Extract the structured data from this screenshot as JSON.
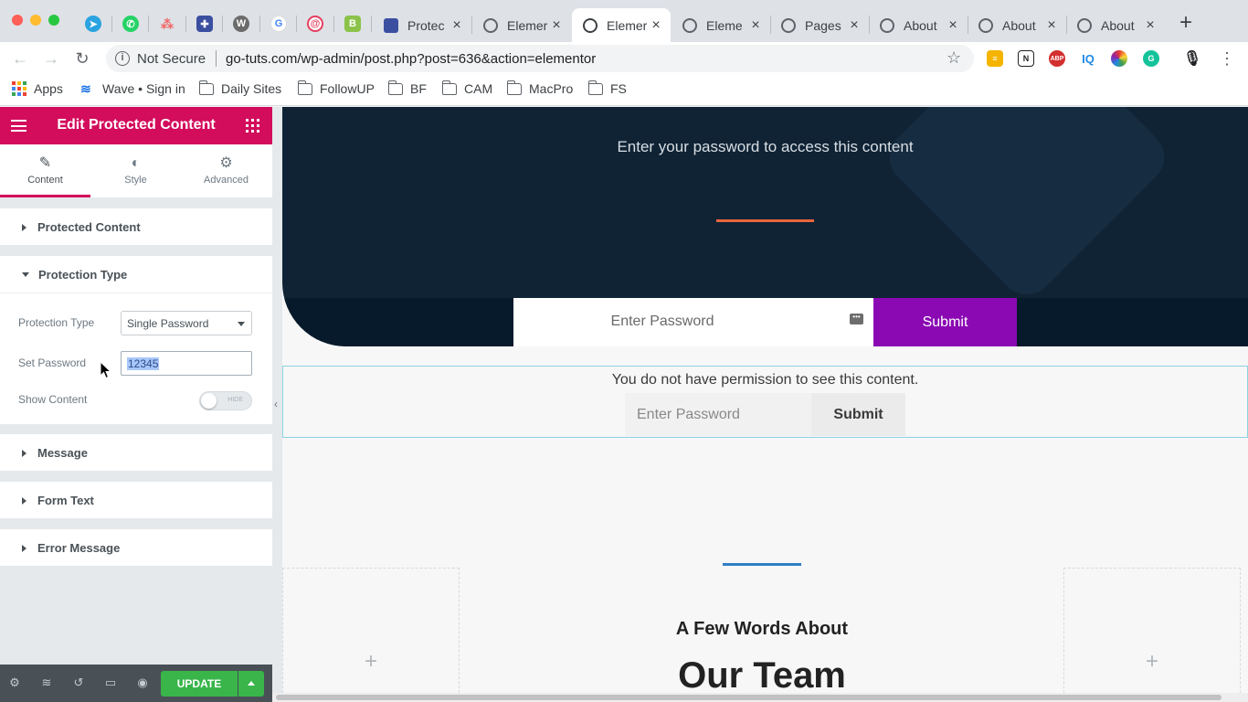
{
  "tabs": [
    {
      "title": "Protec",
      "icon": "wpforms-icon",
      "color": "#3b4fa0",
      "active": false
    },
    {
      "title": "Elemer",
      "icon": "globe-icon",
      "color": "#5f6368",
      "active": false
    },
    {
      "title": "Elemer",
      "icon": "globe-icon",
      "color": "#5f6368",
      "active": true
    },
    {
      "title": "Eleme",
      "icon": "globe-icon",
      "color": "#5f6368",
      "active": false
    },
    {
      "title": "Pages",
      "icon": "globe-icon",
      "color": "#5f6368",
      "active": false
    },
    {
      "title": "About",
      "icon": "globe-icon",
      "color": "#5f6368",
      "active": false
    },
    {
      "title": "About",
      "icon": "globe-icon",
      "color": "#5f6368",
      "active": false
    },
    {
      "title": "About",
      "icon": "globe-icon",
      "color": "#5f6368",
      "active": false
    }
  ],
  "address": {
    "security_label": "Not Secure",
    "url": "go-tuts.com/wp-admin/post.php?post=636&action=elementor"
  },
  "extensions": [
    {
      "name": "extension-yellow-icon",
      "label": "",
      "color": "#f4b400"
    },
    {
      "name": "extension-notion-icon",
      "label": "N",
      "color": "#202124"
    },
    {
      "name": "extension-abp-icon",
      "label": "ABP",
      "color": "#d32f2f"
    },
    {
      "name": "extension-iq-icon",
      "label": "IQ",
      "color": "#1e88e5"
    },
    {
      "name": "extension-colorpicker-icon",
      "label": "",
      "color": "#8e44ad"
    },
    {
      "name": "extension-grammarly-icon",
      "label": "",
      "color": "#15c39a"
    }
  ],
  "bookmarks": [
    {
      "label": "Apps",
      "type": "apps"
    },
    {
      "label": "Wave • Sign in",
      "type": "wave"
    },
    {
      "label": "Daily Sites",
      "type": "folder"
    },
    {
      "label": "FollowUP",
      "type": "folder"
    },
    {
      "label": "BF",
      "type": "folder"
    },
    {
      "label": "CAM",
      "type": "folder"
    },
    {
      "label": "MacPro",
      "type": "folder"
    },
    {
      "label": "FS",
      "type": "folder"
    }
  ],
  "panel": {
    "title": "Edit Protected Content",
    "tabs": [
      {
        "label": "Content",
        "icon": "pencil-icon",
        "active": true
      },
      {
        "label": "Style",
        "icon": "contrast-icon",
        "active": false
      },
      {
        "label": "Advanced",
        "icon": "gear-icon",
        "active": false
      }
    ],
    "sections": {
      "protected_content": "Protected Content",
      "protection_type": "Protection Type",
      "message": "Message",
      "form_text": "Form Text",
      "error_message": "Error Message"
    },
    "controls": {
      "protection_type_label": "Protection Type",
      "protection_type_value": "Single Password",
      "set_password_label": "Set Password",
      "set_password_value": "12345",
      "show_content_label": "Show Content",
      "show_content_toggle": "HIDE"
    },
    "footer": {
      "update_label": "UPDATE"
    }
  },
  "preview": {
    "hero_subtitle": "Enter your password to access this content",
    "hero_password_placeholder": "Enter Password",
    "hero_submit": "Submit",
    "permission_message": "You do not have permission to see this content.",
    "form_password_placeholder": "Enter Password",
    "form_submit": "Submit",
    "add_icon": "+",
    "team_heading": "A Few Words About",
    "team_title": "Our Team"
  },
  "colors": {
    "elementor_accent": "#d30c5c",
    "hero_bg": "#0f2335",
    "submit_purple": "#8a09b3",
    "update_green": "#39b54a"
  }
}
